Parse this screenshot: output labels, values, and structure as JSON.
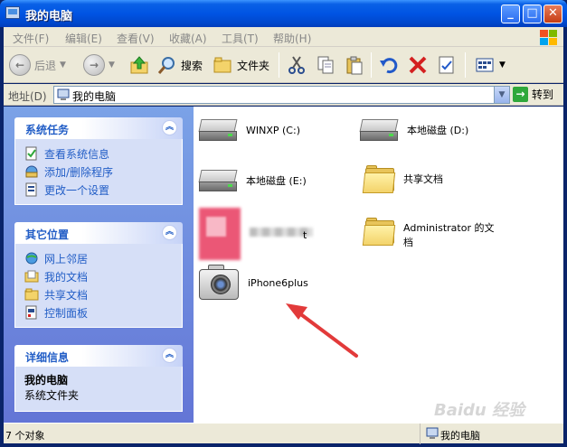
{
  "window": {
    "title": "我的电脑"
  },
  "menu": [
    "文件(F)",
    "编辑(E)",
    "查看(V)",
    "收藏(A)",
    "工具(T)",
    "帮助(H)"
  ],
  "toolbar": {
    "back_label": "后退",
    "search_label": "搜索",
    "folders_label": "文件夹"
  },
  "address": {
    "label": "地址(D)",
    "value": "我的电脑",
    "go_label": "转到"
  },
  "left_panels": {
    "system_tasks": {
      "title": "系统任务",
      "items": [
        "查看系统信息",
        "添加/删除程序",
        "更改一个设置"
      ]
    },
    "other_places": {
      "title": "其它位置",
      "items": [
        "网上邻居",
        "我的文档",
        "共享文档",
        "控制面板"
      ]
    },
    "details": {
      "title": "详细信息",
      "name": "我的电脑",
      "desc": "系统文件夹"
    }
  },
  "items": {
    "drive_c": "WINXP (C:)",
    "drive_d": "本地磁盘 (D:)",
    "drive_e": "本地磁盘 (E:)",
    "shared_docs": "共享文档",
    "admin_docs_1": "Administrator 的文",
    "admin_docs_2": "档",
    "blurred_suffix": "t",
    "camera": "iPhone6plus"
  },
  "status": {
    "count": "7 个对象",
    "location": "我的电脑"
  },
  "watermark": "Baidu 经验",
  "colors": {
    "title_bar": "#0054e3",
    "left_pane": "#7ba2e7",
    "panel_title": "#215dc6",
    "arrow": "#e23a3a"
  }
}
